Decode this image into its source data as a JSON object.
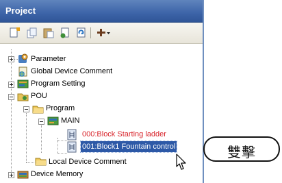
{
  "panel": {
    "title": "Project"
  },
  "toolbar": {
    "buttons": [
      {
        "name": "new-data-icon"
      },
      {
        "name": "copy-icon"
      },
      {
        "name": "paste-icon"
      },
      {
        "name": "properties-icon"
      },
      {
        "name": "refresh-icon"
      },
      {
        "name": "tool-menu-icon"
      }
    ]
  },
  "tree": {
    "items": [
      {
        "label": "Parameter",
        "level": 0,
        "expander": "plus"
      },
      {
        "label": "Global Device Comment",
        "level": 0,
        "expander": "none"
      },
      {
        "label": "Program Setting",
        "level": 0,
        "expander": "plus"
      },
      {
        "label": "POU",
        "level": 0,
        "expander": "minus"
      },
      {
        "label": "Program",
        "level": 1,
        "expander": "minus"
      },
      {
        "label": "MAIN",
        "level": 2,
        "expander": "minus"
      },
      {
        "label": "000:Block Starting ladder",
        "level": 3,
        "color": "#d8232a"
      },
      {
        "label": "001:Block1 Fountain control",
        "level": 3,
        "selected": true
      },
      {
        "label": "Local Device Comment",
        "level": 1,
        "expander": "none"
      },
      {
        "label": "Device Memory",
        "level": 0,
        "expander": "plus"
      }
    ]
  },
  "callout": {
    "text": "雙擊"
  },
  "colors": {
    "title_bar": "#3d64a8",
    "selection": "#2d59a7",
    "highlight_text": "#d8232a"
  }
}
